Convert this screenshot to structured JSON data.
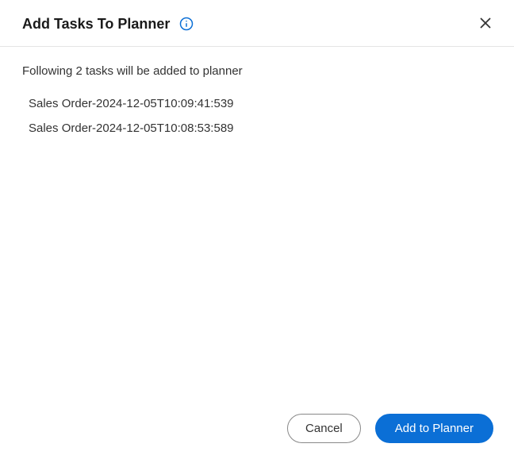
{
  "dialog": {
    "title": "Add Tasks To Planner",
    "description": "Following 2 tasks will be added to planner",
    "tasks": [
      "Sales Order-2024-12-05T10:09:41:539",
      "Sales Order-2024-12-05T10:08:53:589"
    ],
    "cancel_label": "Cancel",
    "confirm_label": "Add to Planner"
  }
}
